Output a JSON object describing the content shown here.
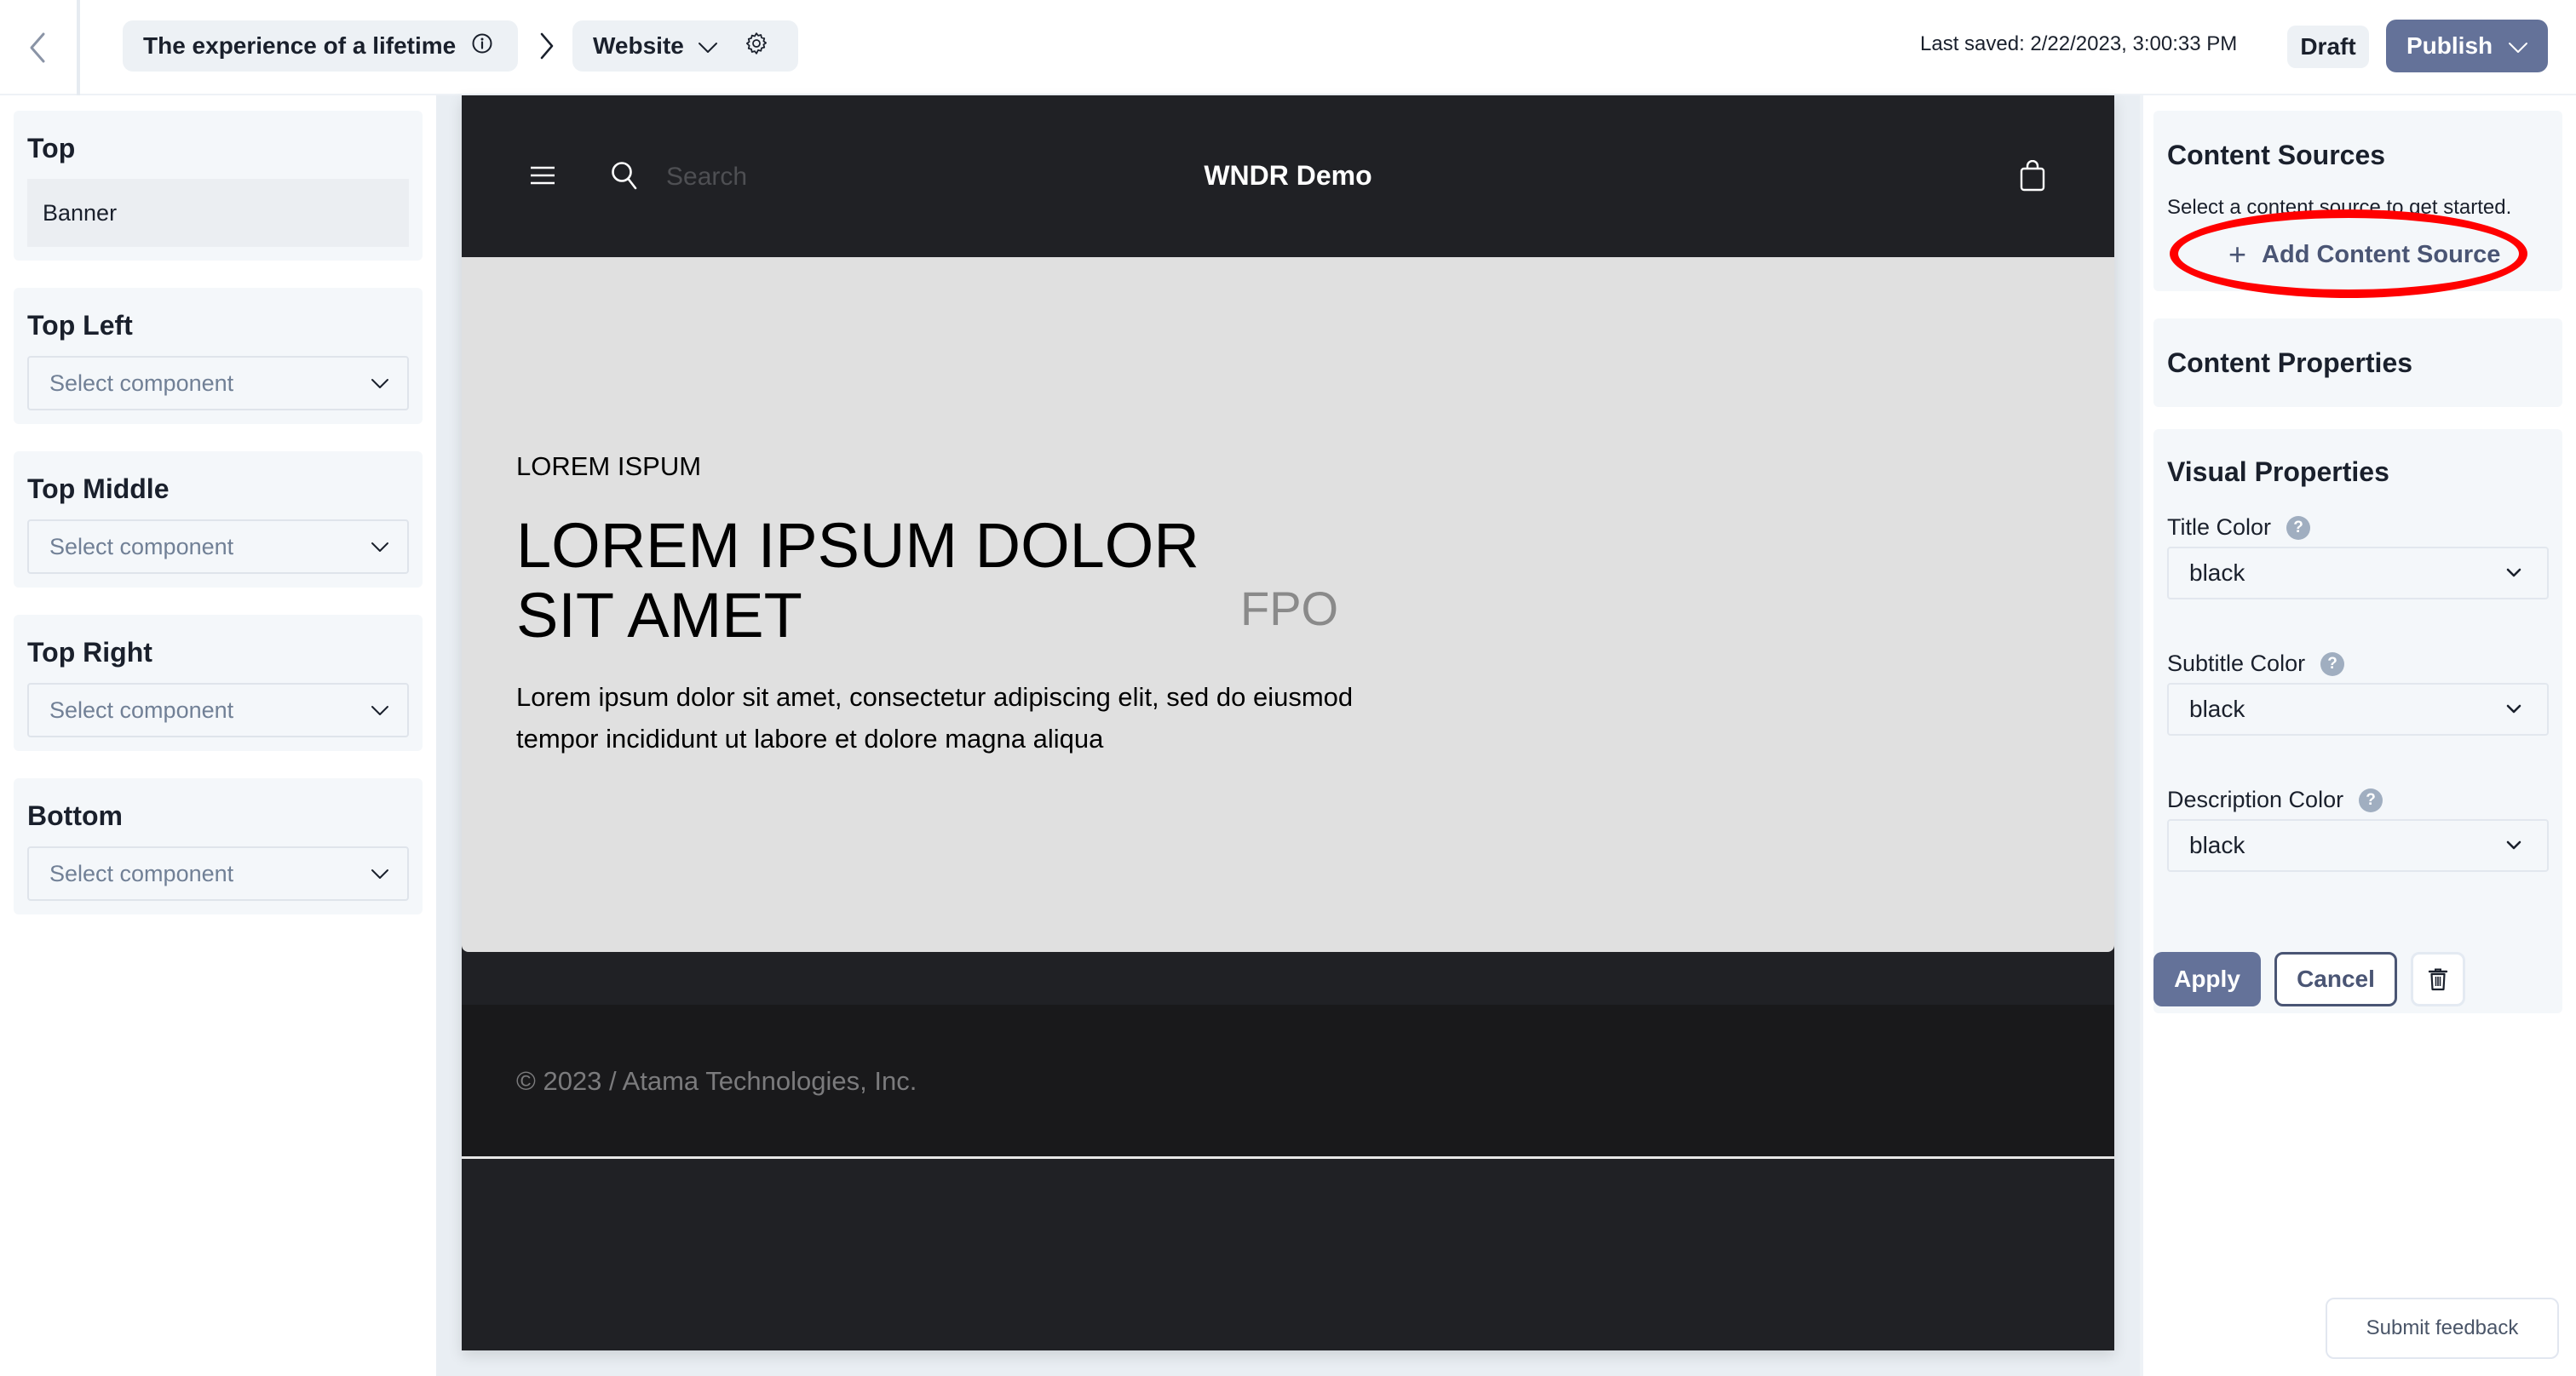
{
  "topbar": {
    "back_icon": "chevron-left-icon",
    "breadcrumb": [
      {
        "label": "The experience of a lifetime",
        "icon": "info-circle-icon"
      },
      {
        "label": "Website",
        "icon": "chevron-down-icon",
        "settings_icon": "gear-icon"
      }
    ],
    "separator_icon": "chevron-right-icon",
    "last_saved": "Last saved: 2/22/2023, 3:00:33 PM",
    "status_badge": "Draft",
    "publish_label": "Publish",
    "accent_color": "#647299"
  },
  "left_panel": {
    "slots": [
      {
        "title": "Top",
        "value": "Banner"
      },
      {
        "title": "Top Left",
        "placeholder": "Select component"
      },
      {
        "title": "Top Middle",
        "placeholder": "Select component"
      },
      {
        "title": "Top Right",
        "placeholder": "Select component"
      },
      {
        "title": "Bottom",
        "placeholder": "Select component"
      }
    ]
  },
  "preview": {
    "header": {
      "menu_icon": "hamburger-menu-icon",
      "search_icon": "search-icon",
      "search_placeholder": "Search",
      "site_title": "WNDR Demo",
      "cart_icon": "shopping-bag-icon"
    },
    "hero": {
      "eyebrow": "LOREM ISPUM",
      "title": "LOREM IPSUM DOLOR SIT AMET",
      "fpo": "FPO",
      "description": "Lorem ipsum dolor sit amet, consectetur adipiscing elit, sed do eiusmod tempor incididunt ut labore et dolore magna aliqua"
    },
    "footer": {
      "copyright": "© 2023 / Atama Technologies, Inc."
    }
  },
  "right_panel": {
    "content_sources": {
      "title": "Content Sources",
      "subtitle": "Select a content source to get started.",
      "add_label": "Add Content Source",
      "add_icon": "plus-icon",
      "annotation": "red-ellipse-highlight"
    },
    "content_properties": {
      "title": "Content Properties"
    },
    "visual_properties": {
      "title": "Visual Properties",
      "fields": [
        {
          "label": "Title Color",
          "value": "black",
          "help_icon": "question-circle-icon"
        },
        {
          "label": "Subtitle Color",
          "value": "black",
          "help_icon": "question-circle-icon"
        },
        {
          "label": "Description Color",
          "value": "black",
          "help_icon": "question-circle-icon"
        }
      ]
    },
    "actions": {
      "apply": "Apply",
      "cancel": "Cancel",
      "delete_icon": "trash-icon"
    },
    "feedback": "Submit feedback"
  }
}
